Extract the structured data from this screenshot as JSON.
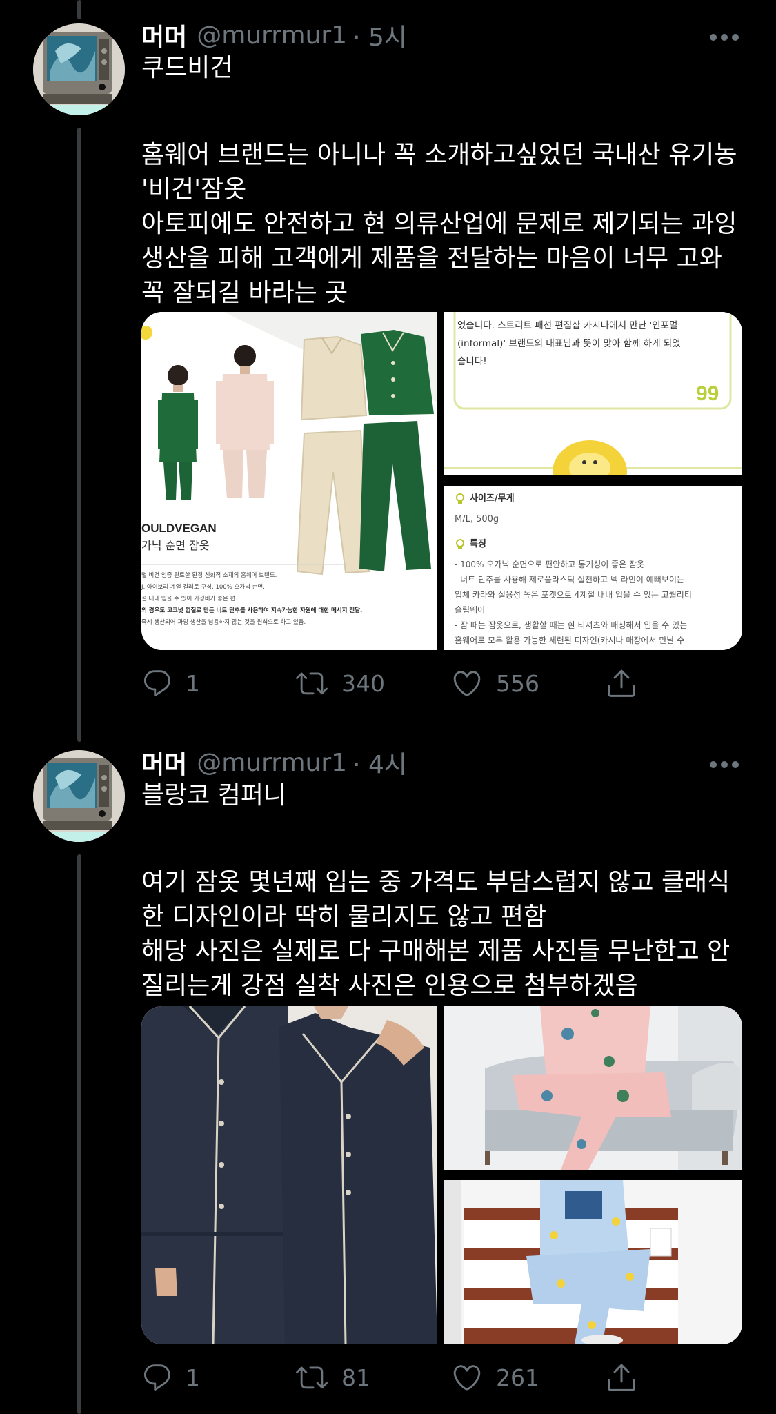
{
  "tweets": [
    {
      "author": {
        "name": "머머",
        "handle": "@murrmur1",
        "time": "· 5시"
      },
      "lines": [
        "쿠드비건",
        "",
        "홈웨어 브랜드는 아니나 꼭 소개하고싶었던 국내산 유기농",
        "'비건'잠옷",
        "아토피에도 안전하고 현 의류산업에 문제로 제기되는 과잉",
        "생산을 피해 고객에게 제품을 전달하는 마음이 너무 고와",
        "꼭 잘되길 바라는 곳"
      ],
      "media": {
        "image1": {
          "brand": "OULDVEGAN",
          "subtitle": "가닉 순면 잠옷",
          "notes": [
            "별 비건 인증 완료한 환경 친화적 소재의 홈웨어 브랜드.",
            "J, 아이보리 계열 컬러로 구성. 100% 오가닉 순면.",
            "절 내내 입을 수 있어 가성비가 좋은 편.",
            "의 경우도 코코넛 껍질로 만든 너트 단추를 사용하여 지속가능한 자원에 대한 메시지 전달.",
            "즉시 생산되어 과잉 생산을 남용하지 않는 것을 원칙으로 하고 있음."
          ]
        },
        "image2": {
          "lines": [
            "었습니다. 스트리트 패션 편집샵 카시나에서 만난 '인포멀",
            "(informal)' 브랜드의 대표님과 뜻이 맞아 함께 하게 되었",
            "습니다!"
          ],
          "quote_mark": "99"
        },
        "image3": {
          "size_heading": "사이즈/무게",
          "size_value": "M/L, 500g",
          "feature_heading": "특징",
          "features": [
            "- 100% 오가닉 순면으로 편안하고 통기성이 좋은 잠옷",
            "- 너트 단추를 사용해 제로플라스틱 실천하고 넥 라인이 예뻐보이는",
            "입체 카라와 실용성 높은 포켓으로 4계절 내내 입을 수 있는 고퀄리티",
            "슬립웨어",
            "- 잠 때는 잠옷으로, 생활할 때는 흰 티셔츠와 매칭해서 입을 수 있는",
            "홈웨어로 모두 활용 가능한 세련된 디자인(카시나 매장에서 만날 수"
          ]
        }
      },
      "stats": {
        "replies": "1",
        "retweets": "340",
        "likes": "556"
      }
    },
    {
      "author": {
        "name": "머머",
        "handle": "@murrmur1",
        "time": "· 4시"
      },
      "lines": [
        "블랑코 컴퍼니",
        "",
        "여기 잠옷 몇년째 입는 중 가격도 부담스럽지 않고 클래식",
        "한 디자인이라 딱히 물리지도 않고 편함",
        "해당 사진은 실제로 다 구매해본 제품 사진들 무난한고 안",
        "질리는게 강점 실착 사진은 인용으로 첨부하겠음"
      ],
      "stats": {
        "replies": "1",
        "retweets": "81",
        "likes": "261"
      }
    }
  ],
  "colors": {
    "background": "#000000",
    "text": "#ffffff",
    "muted": "#6e767d",
    "thread_line": "#3a3d40",
    "pajama_green": "#1f6b3a",
    "pajama_cream": "#eadfc4",
    "pajama_navy": "#283142",
    "pajama_pink": "#f3c5c3",
    "pajama_blue": "#bcd6ef"
  },
  "icons": {
    "more": "more-icon",
    "reply": "reply-icon",
    "retweet": "retweet-icon",
    "like": "heart-icon",
    "share": "share-icon"
  }
}
